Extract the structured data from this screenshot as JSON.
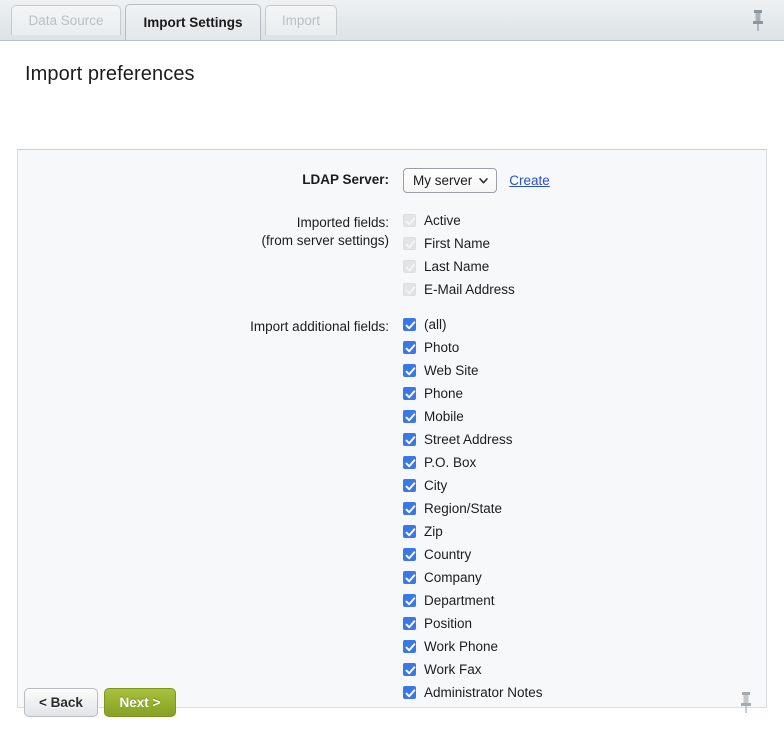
{
  "tabs": [
    {
      "id": "data-source",
      "label": "Data Source",
      "active": false
    },
    {
      "id": "import-settings",
      "label": "Import Settings",
      "active": true
    },
    {
      "id": "import",
      "label": "Import",
      "active": false
    }
  ],
  "icons": {
    "pin_top": "pushpin-icon",
    "pin_bottom": "pushpin-icon",
    "select_chevron": "chevron-down-icon",
    "checkmark": "check-icon"
  },
  "page": {
    "title": "Import preferences"
  },
  "form": {
    "ldap_server": {
      "label": "LDAP Server:",
      "selected": "My server",
      "options": [
        "My server"
      ],
      "create_link": "Create"
    },
    "imported_fields": {
      "label": "Imported fields:",
      "sublabel": "(from server settings)",
      "items": [
        {
          "label": "Active",
          "checked": true,
          "enabled": false
        },
        {
          "label": "First Name",
          "checked": true,
          "enabled": false
        },
        {
          "label": "Last Name",
          "checked": true,
          "enabled": false
        },
        {
          "label": "E-Mail Address",
          "checked": true,
          "enabled": false
        }
      ]
    },
    "additional_fields": {
      "label": "Import additional fields:",
      "items": [
        {
          "label": "(all)",
          "checked": true,
          "enabled": true
        },
        {
          "label": "Photo",
          "checked": true,
          "enabled": true
        },
        {
          "label": "Web Site",
          "checked": true,
          "enabled": true
        },
        {
          "label": "Phone",
          "checked": true,
          "enabled": true
        },
        {
          "label": "Mobile",
          "checked": true,
          "enabled": true
        },
        {
          "label": "Street Address",
          "checked": true,
          "enabled": true
        },
        {
          "label": "P.O. Box",
          "checked": true,
          "enabled": true
        },
        {
          "label": "City",
          "checked": true,
          "enabled": true
        },
        {
          "label": "Region/State",
          "checked": true,
          "enabled": true
        },
        {
          "label": "Zip",
          "checked": true,
          "enabled": true
        },
        {
          "label": "Country",
          "checked": true,
          "enabled": true
        },
        {
          "label": "Company",
          "checked": true,
          "enabled": true
        },
        {
          "label": "Department",
          "checked": true,
          "enabled": true
        },
        {
          "label": "Position",
          "checked": true,
          "enabled": true
        },
        {
          "label": "Work Phone",
          "checked": true,
          "enabled": true
        },
        {
          "label": "Work Fax",
          "checked": true,
          "enabled": true
        },
        {
          "label": "Administrator Notes",
          "checked": true,
          "enabled": true
        }
      ]
    }
  },
  "footer": {
    "back_label": "< Back",
    "next_label": "Next >"
  },
  "colors": {
    "accent_checkbox": "#3b78e7",
    "link": "#2a4fce",
    "next_button": "#93af2c",
    "tab_inactive_text": "#b9c0c4"
  }
}
